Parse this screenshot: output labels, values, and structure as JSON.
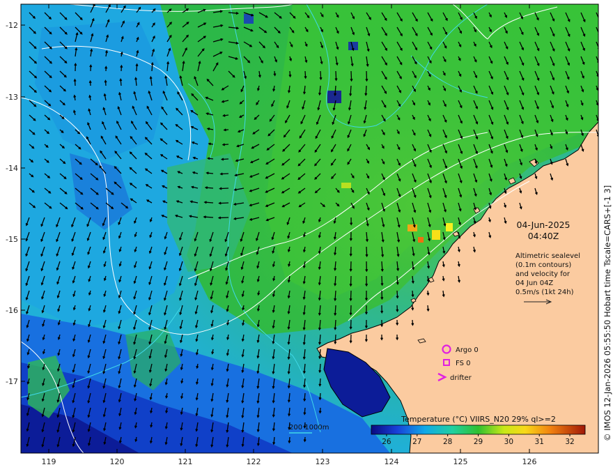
{
  "map": {
    "lat_ticks": [
      "-12",
      "-13",
      "-14",
      "-15",
      "-16",
      "-17"
    ],
    "lon_ticks": [
      "119",
      "120",
      "121",
      "122",
      "123",
      "124",
      "125",
      "126"
    ],
    "date": "04-Jun-2025",
    "time": "04:40Z",
    "info_lines": [
      "Altimetric sealevel",
      "(0.1m contours)",
      "and velocity for",
      "04 Jun 04Z",
      "0.5m/s (1kt 24h)"
    ],
    "legend": {
      "argo": "Argo 0",
      "fs": "FS 0",
      "drifter": "drifter"
    },
    "bathy_label": "200  1000m",
    "colorbar": {
      "title": "Temperature (°C) VIIRS_N20 29% ql>=2",
      "ticks": [
        "26",
        "27",
        "28",
        "29",
        "30",
        "31",
        "32"
      ],
      "min": 25.5,
      "max": 32.5
    },
    "credit": "© IMOS 12-Jan-2026 05:55:50 Hobart time Tscale=CARS+[-1 3]",
    "colors": {
      "land": "#fbcba0",
      "marker": "#e020e0",
      "bathy": "#40d8e8"
    }
  }
}
